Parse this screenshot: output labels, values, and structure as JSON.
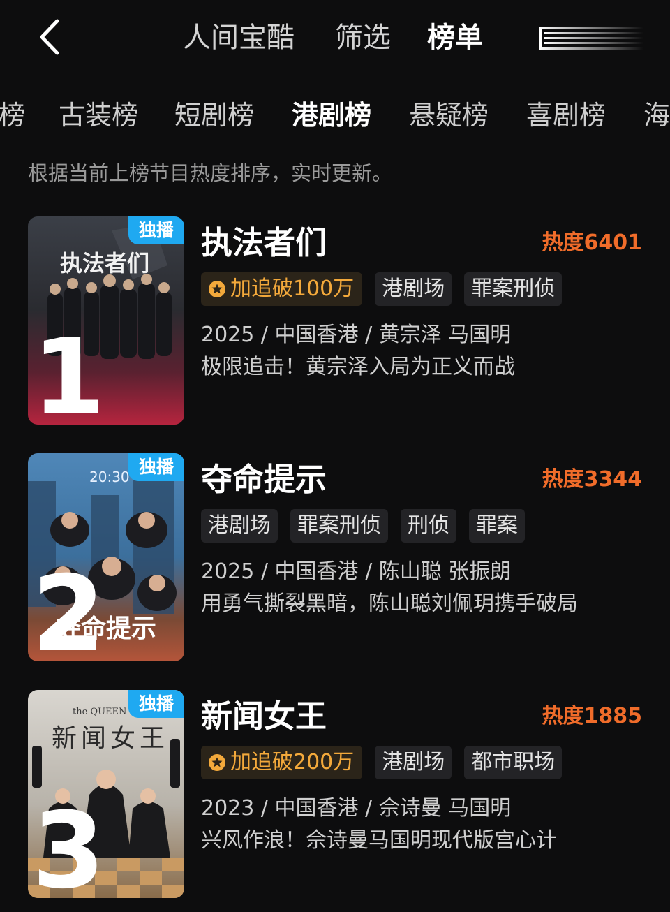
{
  "top_nav": {
    "tabs": [
      "人间宝酷",
      "筛选",
      "榜单"
    ],
    "active_tab": "榜单"
  },
  "category_tabs": {
    "items": [
      "榜",
      "古装榜",
      "短剧榜",
      "港剧榜",
      "悬疑榜",
      "喜剧榜",
      "海"
    ],
    "active": "港剧榜"
  },
  "description": "根据当前上榜节目热度排序，实时更新。",
  "colors": {
    "background": "#0d0d0e",
    "heat": "#f06c2a",
    "badge": "#1fa9f1",
    "gold_tag_text": "#f3a93b"
  },
  "ranking": [
    {
      "rank": "1",
      "badge": "独播",
      "poster_text": "执法者们",
      "title": "执法者们",
      "heat": "热度6401",
      "highlight_tag": "加追破100万",
      "tags": [
        "港剧场",
        "罪案刑侦"
      ],
      "meta": "2025 / 中国香港 / 黄宗泽 马国明",
      "slogan": "极限追击！黄宗泽入局为正义而战"
    },
    {
      "rank": "2",
      "badge": "独播",
      "poster_text": "夺命提示",
      "poster_time": "20:30",
      "title": "夺命提示",
      "heat": "热度3344",
      "highlight_tag": null,
      "tags": [
        "港剧场",
        "罪案刑侦",
        "刑侦",
        "罪案"
      ],
      "meta": "2025 / 中国香港 / 陈山聪 张振朗",
      "slogan": "用勇气撕裂黑暗，陈山聪刘佩玥携手破局"
    },
    {
      "rank": "3",
      "badge": "独播",
      "poster_text": "新闻女王",
      "poster_subtext": "the QUEEN of news",
      "title": "新闻女王",
      "heat": "热度1885",
      "highlight_tag": "加追破200万",
      "tags": [
        "港剧场",
        "都市职场"
      ],
      "meta": "2023 / 中国香港 / 佘诗曼 马国明",
      "slogan": "兴风作浪！佘诗曼马国明现代版宫心计"
    }
  ]
}
